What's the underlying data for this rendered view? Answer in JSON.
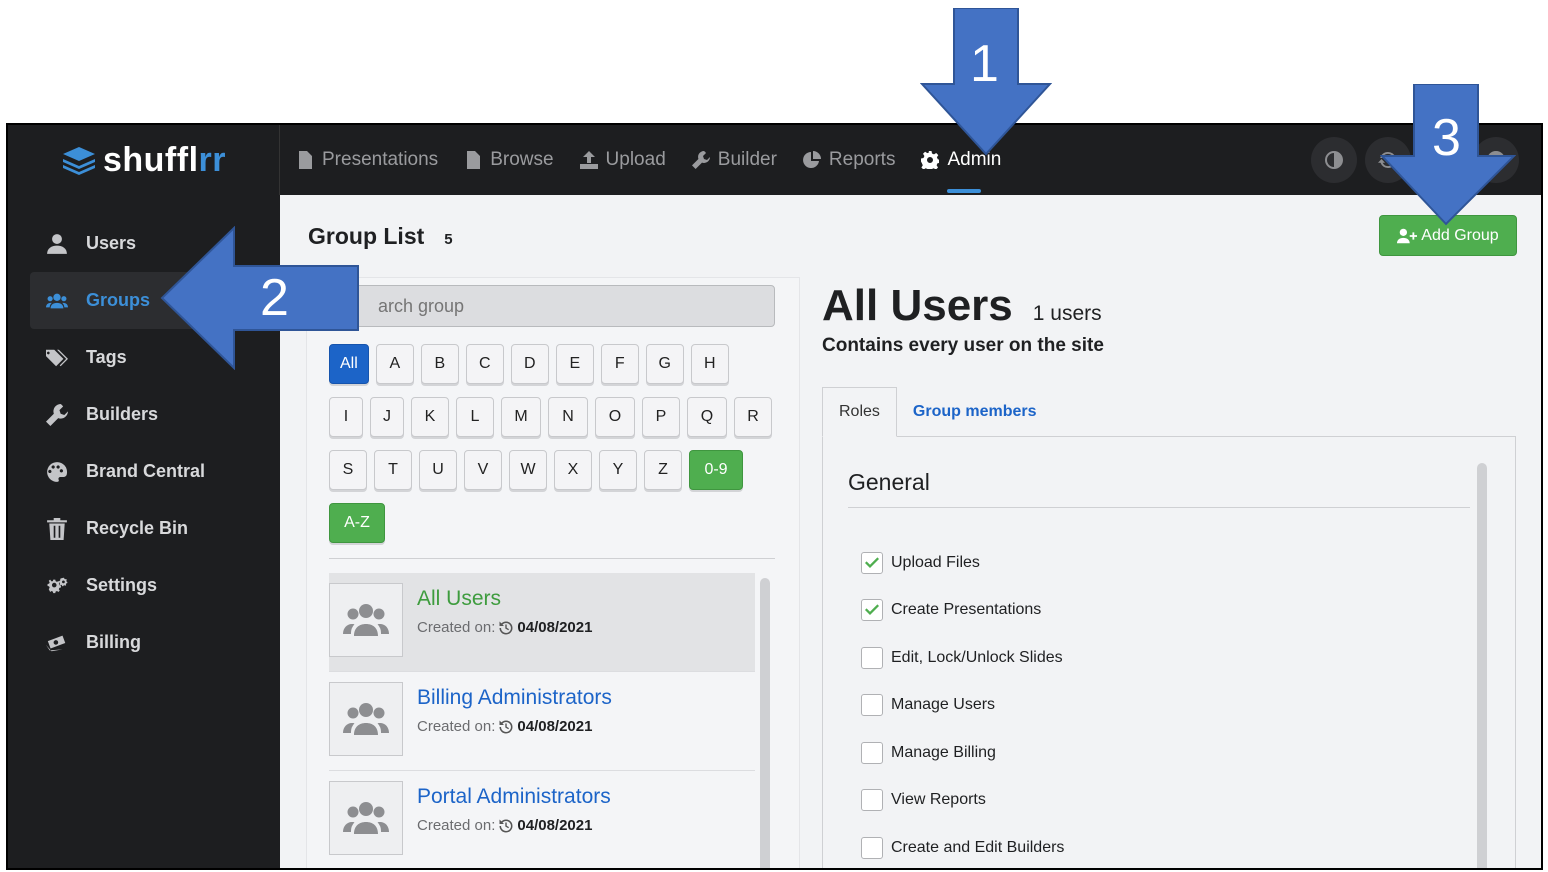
{
  "app": {
    "brand_main": "shuffl",
    "brand_accent": "rr"
  },
  "nav": [
    {
      "label": "Presentations",
      "icon": "file-icon"
    },
    {
      "label": "Browse",
      "icon": "document-icon"
    },
    {
      "label": "Upload",
      "icon": "upload-icon"
    },
    {
      "label": "Builder",
      "icon": "wrench-icon"
    },
    {
      "label": "Reports",
      "icon": "pie-chart-icon"
    },
    {
      "label": "Admin",
      "icon": "gear-icon",
      "active": true
    }
  ],
  "sidebar": {
    "items": [
      {
        "label": "Users",
        "icon": "user-icon"
      },
      {
        "label": "Groups",
        "icon": "users-icon",
        "active": true
      },
      {
        "label": "Tags",
        "icon": "tags-icon"
      },
      {
        "label": "Builders",
        "icon": "wrench-icon"
      },
      {
        "label": "Brand Central",
        "icon": "palette-icon"
      },
      {
        "label": "Recycle Bin",
        "icon": "trash-icon"
      },
      {
        "label": "Settings",
        "icon": "gears-icon"
      },
      {
        "label": "Billing",
        "icon": "money-icon"
      }
    ]
  },
  "main": {
    "title": "Group List",
    "count": "5",
    "add_group_label": "Add Group",
    "search_placeholder": "arch group",
    "letter_rows": [
      [
        "All",
        "A",
        "B",
        "C",
        "D",
        "E",
        "F",
        "G",
        "H"
      ],
      [
        "I",
        "J",
        "K",
        "L",
        "M",
        "N",
        "O",
        "P",
        "Q",
        "R"
      ],
      [
        "S",
        "T",
        "U",
        "V",
        "W",
        "X",
        "Y",
        "Z",
        "0-9"
      ],
      [
        "A-Z"
      ]
    ],
    "groups": [
      {
        "name": "All Users",
        "created_label": "Created on:",
        "date": "04/08/2021",
        "selected": true
      },
      {
        "name": "Billing Administrators",
        "created_label": "Created on:",
        "date": "04/08/2021"
      },
      {
        "name": "Portal Administrators",
        "created_label": "Created on:",
        "date": "04/08/2021"
      }
    ]
  },
  "detail": {
    "name": "All Users",
    "count": "1 users",
    "description": "Contains every user on the site",
    "tabs": [
      {
        "label": "Roles",
        "active": true
      },
      {
        "label": "Group members"
      }
    ],
    "section": "General",
    "permissions": [
      {
        "label": "Upload Files",
        "checked": true
      },
      {
        "label": "Create Presentations",
        "checked": true
      },
      {
        "label": "Edit, Lock/Unlock Slides",
        "checked": false
      },
      {
        "label": "Manage Users",
        "checked": false
      },
      {
        "label": "Manage Billing",
        "checked": false
      },
      {
        "label": "View Reports",
        "checked": false
      },
      {
        "label": "Create and Edit Builders",
        "checked": false
      }
    ]
  },
  "annotations": {
    "step1": "1",
    "step2": "2",
    "step3": "3"
  },
  "colors": {
    "accent": "#3c8fd8",
    "link": "#1c64c8",
    "green": "#4fae4f",
    "callout": "#4472c4",
    "dark": "#1d1e20"
  }
}
